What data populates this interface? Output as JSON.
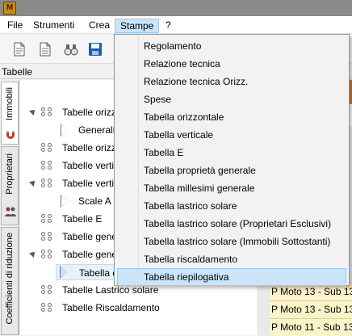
{
  "titlebar": {
    "app_icon_letter": "M"
  },
  "menubar": {
    "items": [
      "File",
      "Strumenti",
      "Crea",
      "Stampe",
      "?"
    ],
    "active": "Stampe"
  },
  "toolbar": {
    "icons": [
      "new-document-icon",
      "open-document-icon",
      "binoculars-icon",
      "save-icon"
    ]
  },
  "panel": {
    "title": "Tabelle"
  },
  "vtabs": [
    "Immobili",
    "Proprietari",
    "Coefficienti di riduzione"
  ],
  "tree": {
    "rows": [
      "Tabelle orizz",
      "Generali",
      "Tabelle orizzo",
      "Tabelle vertic",
      "Tabelle vertic",
      "Scale A",
      "Tabelle E",
      "Tabelle gene",
      "Tabelle gene",
      "Tabella d",
      "Tabelle Lastrico solare",
      "Tabelle Riscaldamento"
    ]
  },
  "rightpanel": {
    "cells": [
      "P Moto 13 - Sub 13",
      "P Moto 13 - Sub 13",
      "P Moto 11 - Sub 13"
    ]
  },
  "dropdown": {
    "items": [
      "Regolamento",
      "Relazione tecnica",
      "Relazione tecnica Orizz.",
      "Spese",
      "Tabella orizzontale",
      "Tabella verticale",
      "Tabella E",
      "Tabella proprietà generale",
      "Tabella millesimi generale",
      "Tabella lastrico solare",
      "Tabella lastrico solare (Proprietari Esclusivi)",
      "Tabella lastrico solare (Immobili Sottostanti)",
      "Tabella riscaldamento",
      "Tabella riepilogativa"
    ],
    "hovered": "Tabella riepilogativa"
  },
  "colors": {
    "menu_active": "#cce4f7",
    "menu_active_border": "#99c9ef",
    "highlight_cell": "#fbf3c9"
  }
}
